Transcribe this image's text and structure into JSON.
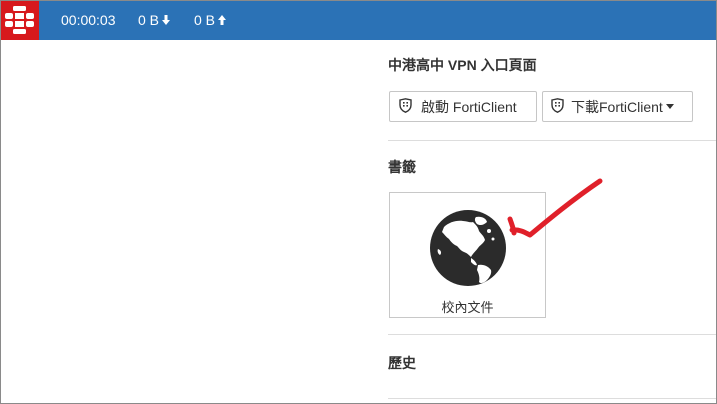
{
  "topbar": {
    "logo_icon": "fortinet-logo-icon",
    "elapsed_time": "00:00:03",
    "bytes_down": "0 B",
    "bytes_up": "0 B"
  },
  "portal": {
    "title": "中港高中 VPN 入口頁面",
    "launch_button": "啟動 FortiClient",
    "download_button": "下載FortiClient"
  },
  "bookmarks": {
    "title": "書籤",
    "items": [
      {
        "label": "校內文件",
        "icon": "globe-icon"
      }
    ]
  },
  "history": {
    "title": "歷史"
  },
  "colors": {
    "topbar": "#2b72b6",
    "logo_bg": "#d7191d",
    "annotation": "#e0202a"
  }
}
